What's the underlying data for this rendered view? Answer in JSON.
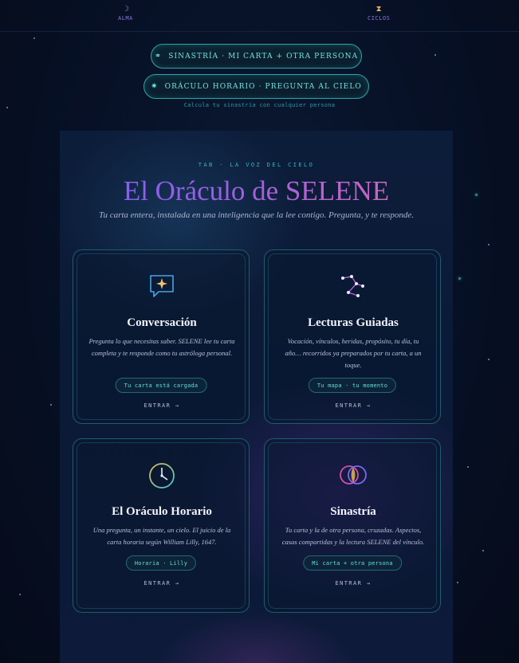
{
  "nav": {
    "alma": {
      "icon": "moon-icon",
      "label": "ALMA"
    },
    "ciclos": {
      "icon": "hourglass-icon",
      "label": "CICLOS"
    }
  },
  "buttons": {
    "sinastria": {
      "icon": "interlocked-rings-icon",
      "label": "SINASTRÍA · MI CARTA + OTRA PERSONA"
    },
    "oraculo": {
      "icon": "sparkle-icon",
      "label": "ORÁCULO HORARIO · PREGUNTA AL CIELO"
    }
  },
  "subnote": "Calcula tu sinastría con cualquier persona",
  "hero": {
    "eyebrow": "TAB · LA VOZ DEL CIELO",
    "title": "El Oráculo de SELENE",
    "subtitle": "Tu carta entera, instalada en una inteligencia que la lee contigo. Pregunta, y te responde."
  },
  "cards": [
    {
      "icon": "chat-sparkle-icon",
      "title": "Conversación",
      "description": "Pregunta lo que necesitas saber. SELENE lee tu carta completa y te responde como tu astróloga personal.",
      "tag": "Tu carta está cargada",
      "cta": "ENTRAR →"
    },
    {
      "icon": "constellation-icon",
      "title": "Lecturas Guiadas",
      "description": "Vocación, vínculos, heridas, propósito, tu día, tu año… recorridos ya preparados por tu carta, a un toque.",
      "tag": "Tu mapa · tu momento",
      "cta": "ENTRAR →"
    },
    {
      "icon": "clock-icon",
      "title": "El Oráculo Horario",
      "description": "Una pregunta, un instante, un cielo. El juicio de la carta horaria según William Lilly, 1647.",
      "tag": "Horaria · Lilly",
      "cta": "ENTRAR →"
    },
    {
      "icon": "overlapping-circles-icon",
      "title": "Sinastría",
      "description": "Tu carta y la de otra persona, cruzadas. Aspectos, casas compartidas y la lectura SELENE del vínculo.",
      "tag": "Mi carta + otra persona",
      "cta": "ENTRAR →"
    }
  ],
  "colors": {
    "background": "#060e1f",
    "accent_teal": "#72e2e0",
    "title_gradient_start": "#7d5ff0",
    "title_gradient_end": "#d26aa6"
  }
}
